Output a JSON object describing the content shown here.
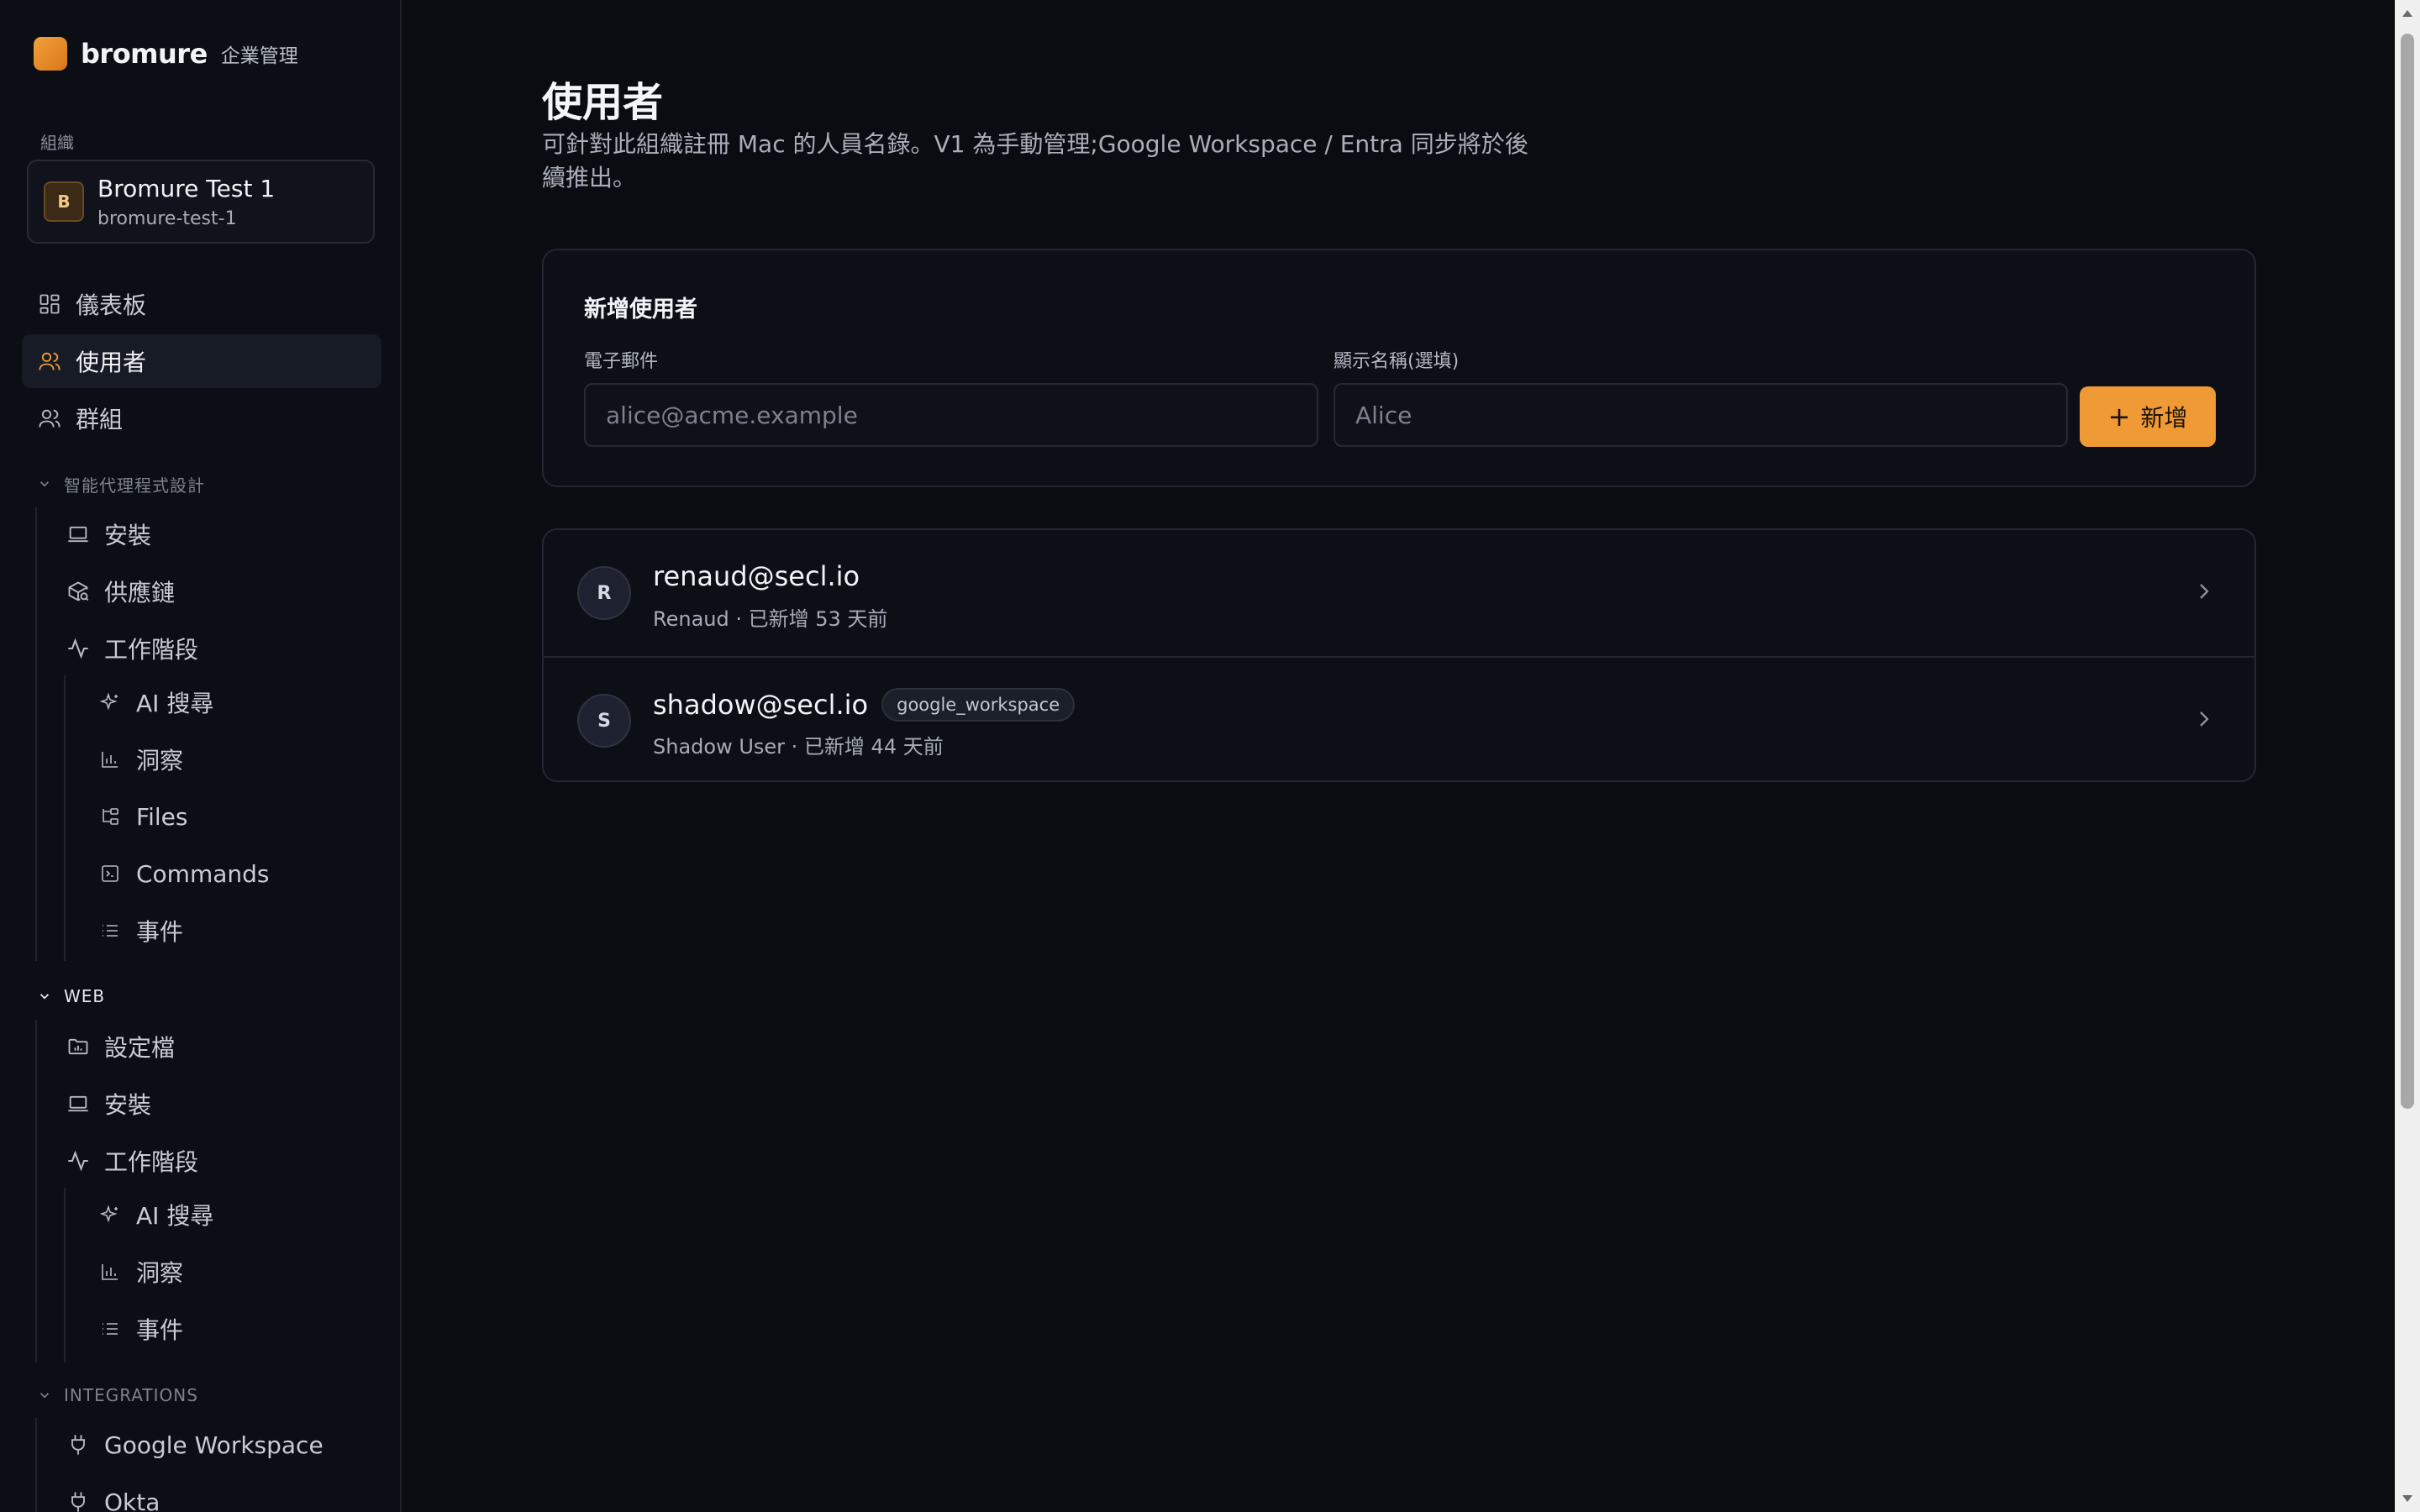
{
  "brand": {
    "name": "bromure",
    "subtitle": "企業管理"
  },
  "org": {
    "label": "組織",
    "initial": "B",
    "name": "Bromure Test 1",
    "slug": "bromure-test-1"
  },
  "nav": {
    "dashboard": "儀表板",
    "users": "使用者",
    "groups": "群組",
    "agent_section": "智能代理程式設計",
    "agent": {
      "install": "安裝",
      "supply_chain": "供應鏈",
      "sessions": "工作階段",
      "ai_search": "AI 搜尋",
      "insights": "洞察",
      "files": "Files",
      "commands": "Commands",
      "events": "事件"
    },
    "web_section": "WEB",
    "web": {
      "profiles": "設定檔",
      "install": "安裝",
      "sessions": "工作階段",
      "ai_search": "AI 搜尋",
      "insights": "洞察",
      "events": "事件"
    },
    "integrations_section": "INTEGRATIONS",
    "integrations": {
      "google": "Google Workspace",
      "okta": "Okta"
    }
  },
  "page": {
    "title": "使用者",
    "description": "可針對此組織註冊 Mac 的人員名錄。V1 為手動管理;Google Workspace / Entra 同步將於後續推出。"
  },
  "add_user": {
    "title": "新增使用者",
    "email_label": "電子郵件",
    "email_placeholder": "alice@acme.example",
    "name_label": "顯示名稱(選填)",
    "name_placeholder": "Alice",
    "button_label": "新增"
  },
  "users": [
    {
      "initial": "R",
      "email": "renaud@secl.io",
      "badge": "",
      "meta": "Renaud · 已新增 53 天前"
    },
    {
      "initial": "S",
      "email": "shadow@secl.io",
      "badge": "google_workspace",
      "meta": "Shadow User · 已新增 44 天前"
    }
  ],
  "colors": {
    "accent": "#ef9a34",
    "background": "#0a0c12",
    "sidebar": "#0b0e15",
    "border": "#232733"
  }
}
